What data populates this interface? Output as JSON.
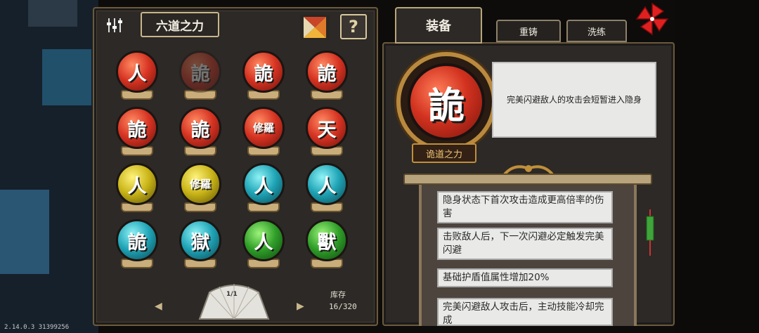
{
  "version": "2.14.0.3 31399256",
  "left_panel": {
    "title": "六道之力",
    "help": "?",
    "page": "1/1",
    "stock_label": "库存",
    "stock_count": "16/320"
  },
  "orbs": [
    {
      "glyph": "人",
      "color": "red",
      "dim": false
    },
    {
      "glyph": "詭",
      "color": "red",
      "dim": true
    },
    {
      "glyph": "詭",
      "color": "red",
      "dim": false
    },
    {
      "glyph": "詭",
      "color": "red",
      "dim": false
    },
    {
      "glyph": "詭",
      "color": "red",
      "dim": false
    },
    {
      "glyph": "詭",
      "color": "red",
      "dim": false
    },
    {
      "glyph": "修羅",
      "color": "red",
      "dim": false
    },
    {
      "glyph": "天",
      "color": "red",
      "dim": false
    },
    {
      "glyph": "人",
      "color": "yellow",
      "dim": false
    },
    {
      "glyph": "修羅",
      "color": "yellow",
      "dim": false
    },
    {
      "glyph": "人",
      "color": "teal",
      "dim": false
    },
    {
      "glyph": "人",
      "color": "teal",
      "dim": false
    },
    {
      "glyph": "詭",
      "color": "teal",
      "dim": false
    },
    {
      "glyph": "獄",
      "color": "teal",
      "dim": false
    },
    {
      "glyph": "人",
      "color": "green",
      "dim": false
    },
    {
      "glyph": "獸",
      "color": "green",
      "dim": false
    }
  ],
  "tabs": [
    "装备",
    "重铸",
    "洗练"
  ],
  "detail": {
    "glyph": "詭",
    "description": "完美闪避敌人的攻击会短暂进入隐身",
    "name": "诡道之力"
  },
  "effects": [
    "隐身状态下首次攻击造成更高倍率的伤害",
    "击败敌人后，下一次闪避必定触发完美闪避",
    "基础护盾值属性增加20%",
    "完美闪避敌人攻击后，主动技能冷却完成"
  ],
  "colors": {
    "red": [
      "#ff8a62",
      "#d63322",
      "#6e120b"
    ],
    "yellow": [
      "#fff27a",
      "#c9b417",
      "#5e5206"
    ],
    "teal": [
      "#8ff2f6",
      "#1fa4b6",
      "#0b4852"
    ],
    "green": [
      "#9cf37a",
      "#2f9e28",
      "#0f4a10"
    ]
  }
}
